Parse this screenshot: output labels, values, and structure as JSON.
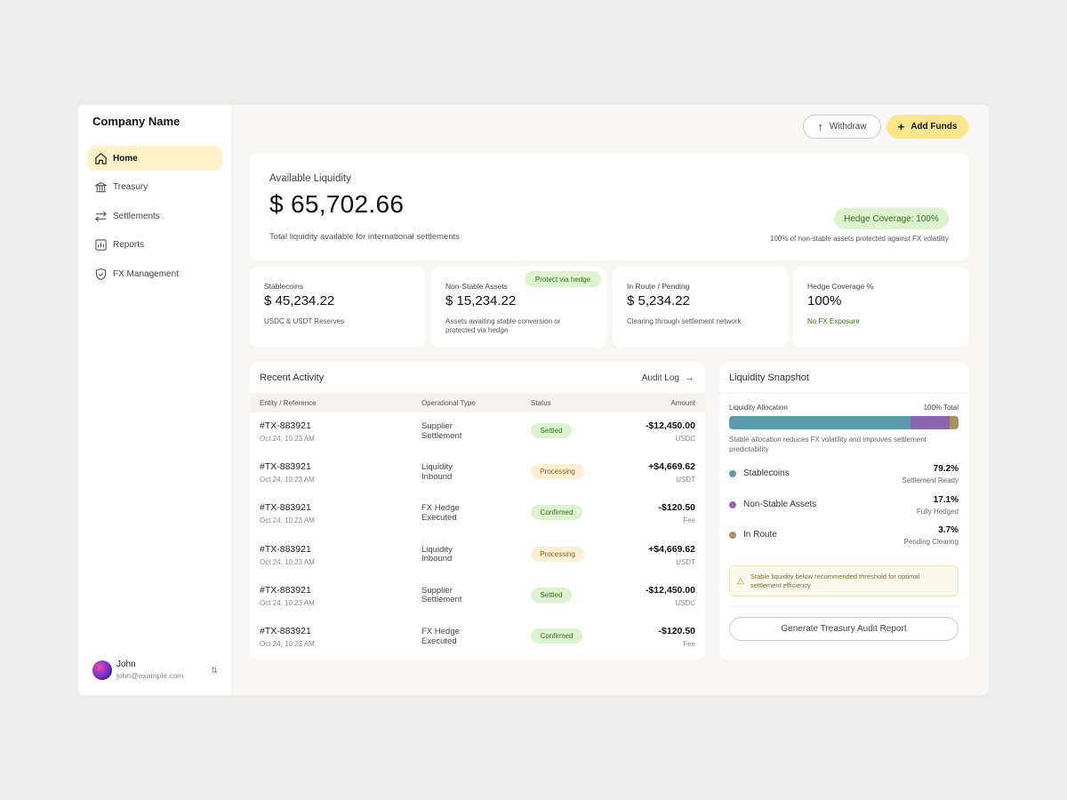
{
  "company": "Company Name",
  "nav": [
    {
      "label": "Home",
      "icon": "home-icon"
    },
    {
      "label": "Treasury",
      "icon": "bank-icon"
    },
    {
      "label": "Settlements",
      "icon": "transfer-icon"
    },
    {
      "label": "Reports",
      "icon": "chart-icon"
    },
    {
      "label": "FX Management",
      "icon": "shield-icon"
    }
  ],
  "user": {
    "name": "John",
    "email": "john@example.com"
  },
  "actions": {
    "withdraw": "Withdraw",
    "add_funds": "Add Funds"
  },
  "hero": {
    "label": "Available Liquidity",
    "value": "$ 65,702.66",
    "sub": "Total liquidity available for international settlements",
    "hedge_pill": "Hedge Coverage: 100%",
    "hedge_note": "100% of non-stable assets protected against FX volatility"
  },
  "stats": [
    {
      "label": "Stablecoins",
      "value": "$ 45,234.22",
      "sub": "USDC & USDT Reserves"
    },
    {
      "label": "Non-Stable Assets",
      "value": "$ 15,234.22",
      "sub": "Assets awaiting stable conversion or protected via hedge",
      "pill": "Protect via hedge"
    },
    {
      "label": "In Route / Pending",
      "value": "$ 5,234.22",
      "sub": "Clearing through settlement network"
    },
    {
      "label": "Hedge Coverage %",
      "value": "100%",
      "sub": "No FX Exposure"
    }
  ],
  "activity": {
    "title": "Recent Activity",
    "audit_link": "Audit Log",
    "columns": [
      "Entity / Reference",
      "Operational Type",
      "Status",
      "Amount"
    ],
    "rows": [
      {
        "ref": "#TX-883921",
        "time": "Oct 24, 10:23 AM",
        "type1": "Supplier",
        "type2": "Settlement",
        "status": "Settled",
        "status_kind": "green",
        "amount": "-$12,450.00",
        "currency": "USDC"
      },
      {
        "ref": "#TX-883921",
        "time": "Oct 24, 10:23 AM",
        "type1": "Liquidity",
        "type2": "Inbound",
        "status": "Processing",
        "status_kind": "amber",
        "amount": "+$4,669.62",
        "currency": "USDT"
      },
      {
        "ref": "#TX-883921",
        "time": "Oct 24, 10:23 AM",
        "type1": "FX Hedge",
        "type2": "Executed",
        "status": "Confirmed",
        "status_kind": "green",
        "amount": "-$120.50",
        "currency": "Fee"
      },
      {
        "ref": "#TX-883921",
        "time": "Oct 24, 10:23 AM",
        "type1": "Liquidity",
        "type2": "Inbound",
        "status": "Processing",
        "status_kind": "amber",
        "amount": "+$4,669.62",
        "currency": "USDT"
      },
      {
        "ref": "#TX-883921",
        "time": "Oct 24, 10:23 AM",
        "type1": "Supplier",
        "type2": "Settlement",
        "status": "Settled",
        "status_kind": "green",
        "amount": "-$12,450.00",
        "currency": "USDC"
      },
      {
        "ref": "#TX-883921",
        "time": "Oct 24, 10:23 AM",
        "type1": "FX Hedge",
        "type2": "Executed",
        "status": "Confirmed",
        "status_kind": "green",
        "amount": "-$120.50",
        "currency": "Fee"
      }
    ]
  },
  "snapshot": {
    "title": "Liquidity Snapshot",
    "alloc_label": "Liquidity Allocation",
    "alloc_total": "100% Total",
    "note": "Stable allocation reduces FX volatility and improves settlement predictability",
    "segments": [
      {
        "name": "Stablecoins",
        "pct": "79.2%",
        "share": 79.2,
        "sub": "Settlement Ready",
        "color": "#5b9aa8"
      },
      {
        "name": "Non-Stable Assets",
        "pct": "17.1%",
        "share": 17.1,
        "sub": "Fully Hedged",
        "color": "#8b67b0"
      },
      {
        "name": "In Route",
        "pct": "3.7%",
        "share": 3.7,
        "sub": "Pending Clearing",
        "color": "#a8915a"
      }
    ],
    "warning": "Stable liquidity below recommended threshold for optimal settlement efficiency",
    "button": "Generate Treasury Audit Report"
  }
}
